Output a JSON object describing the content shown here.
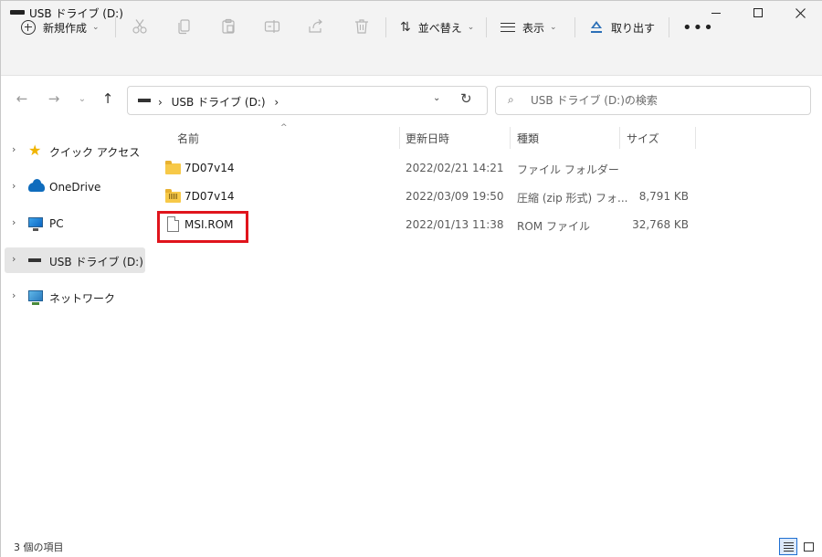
{
  "window": {
    "title": "USB ドライブ (D:)"
  },
  "toolbar": {
    "new_label": "新規作成",
    "sort_label": "並べ替え",
    "view_label": "表示",
    "eject_label": "取り出す",
    "more_label": "•••",
    "disabled_icons": [
      "cut-icon",
      "copy-icon",
      "paste-icon",
      "rename-icon",
      "share-icon",
      "delete-icon"
    ]
  },
  "address": {
    "path": "USB ドライブ (D:)",
    "separator": "›"
  },
  "search": {
    "placeholder": "USB ドライブ (D:)の検索"
  },
  "nav": {
    "items": [
      {
        "label": "クイック アクセス",
        "icon": "star-icon"
      },
      {
        "label": "OneDrive",
        "icon": "cloud-icon"
      },
      {
        "label": "PC",
        "icon": "pc-icon"
      },
      {
        "label": "USB ドライブ (D:)",
        "icon": "usb-drive-icon",
        "selected": true
      },
      {
        "label": "ネットワーク",
        "icon": "network-icon"
      }
    ]
  },
  "columns": {
    "name": "名前",
    "date": "更新日時",
    "type": "種類",
    "size": "サイズ"
  },
  "files": [
    {
      "name": "7D07v14",
      "date": "2022/02/21 14:21",
      "type": "ファイル フォルダー",
      "size": "",
      "icon": "folder-icon"
    },
    {
      "name": "7D07v14",
      "date": "2022/03/09 19:50",
      "type": "圧縮 (zip 形式) フォ...",
      "size": "8,791 KB",
      "icon": "zip-folder-icon"
    },
    {
      "name": "MSI.ROM",
      "date": "2022/01/13 11:38",
      "type": "ROM ファイル",
      "size": "32,768 KB",
      "icon": "document-icon"
    }
  ],
  "status": {
    "item_count": "3 個の項目"
  },
  "colors": {
    "highlight": "#e0141c",
    "accent": "#1f6fd1",
    "folder": "#f7c948"
  }
}
